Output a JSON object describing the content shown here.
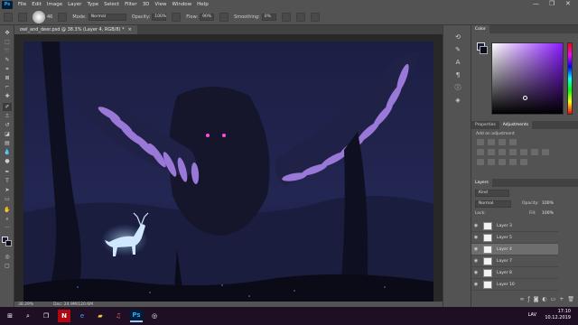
{
  "menubar": {
    "logo": "Ps",
    "items": [
      "File",
      "Edit",
      "Image",
      "Layer",
      "Type",
      "Select",
      "Filter",
      "3D",
      "View",
      "Window",
      "Help"
    ],
    "window_controls": [
      "—",
      "❐",
      "✕"
    ]
  },
  "options": {
    "brush_size": "46",
    "mode_label": "Mode:",
    "mode_value": "Normal",
    "opacity_label": "Opacity:",
    "opacity_value": "100%",
    "flow_label": "Flow:",
    "flow_value": "90%",
    "smoothing_label": "Smoothing:",
    "smoothing_value": "0%"
  },
  "document": {
    "tab_title": "owl_and_deer.psd @ 38.3% (Layer 4, RGB/8) *",
    "close_glyph": "×"
  },
  "status": {
    "zoom": "38.29%",
    "doc_size": "Doc: 24.9M/120.6M"
  },
  "color_panel": {
    "tab_label": "Color",
    "hue_accent": "#8a1bff",
    "foreground": "#1a1d3a",
    "background": "#0b0c1c"
  },
  "adjustments_panel": {
    "tabs": [
      "Properties",
      "Adjustments"
    ],
    "active_tab": "Adjustments",
    "add_label": "Add an adjustment"
  },
  "layers_panel": {
    "tab_label": "Layers",
    "filter_label": "Kind",
    "blend_mode": "Normal",
    "opacity_label": "Opacity:",
    "opacity_value": "100%",
    "lock_label": "Lock:",
    "fill_label": "Fill:",
    "fill_value": "100%",
    "layers": [
      {
        "name": "Layer 3",
        "selected": false
      },
      {
        "name": "Layer 5",
        "selected": false
      },
      {
        "name": "Layer 4",
        "selected": true
      },
      {
        "name": "Layer 7",
        "selected": false
      },
      {
        "name": "Layer 8",
        "selected": false
      },
      {
        "name": "Layer 10",
        "selected": false
      }
    ]
  },
  "taskbar": {
    "time": "17:10",
    "date": "10.12.2019",
    "lang": "LAV",
    "apps": [
      "start",
      "search",
      "task-view",
      "netflix",
      "edge",
      "explorer",
      "music",
      "photoshop",
      "other"
    ]
  }
}
